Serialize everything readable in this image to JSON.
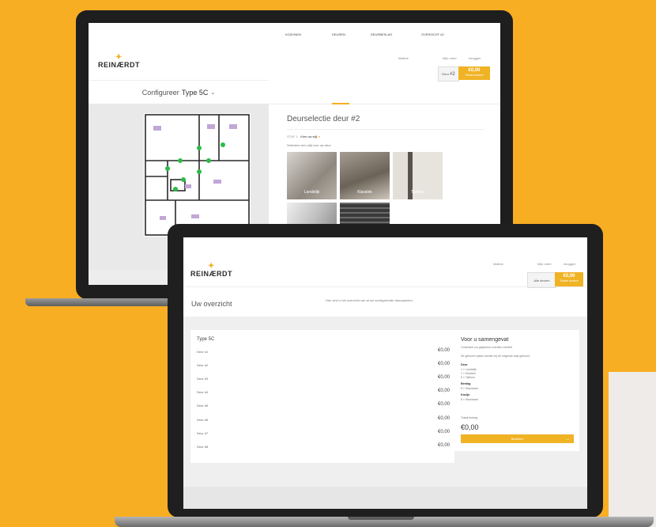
{
  "brand": {
    "name": "REINÆRDT"
  },
  "back_screen": {
    "util": {
      "mail": "Mailtoe",
      "search": "Mijn order",
      "login": "Inloggen"
    },
    "door_badge": {
      "label": "Deur",
      "number": "#2"
    },
    "total": {
      "amount": "€0,00",
      "note": "Totale kosten"
    },
    "configure": {
      "prefix": "Configureer",
      "type": "Type 5C"
    },
    "tabs": [
      {
        "label": "KOZIJNEN"
      },
      {
        "label": "DEUREN"
      },
      {
        "label": "DEURBESLAG"
      },
      {
        "label": "OVERZICHT"
      }
    ],
    "last_tab_suffix": "#2",
    "title": "Deurselectie deur #2",
    "step": {
      "num": "STAP 1",
      "label": "Kies uw stijl"
    },
    "subtitle": "Selecteer een stijl voor uw deur",
    "doors": [
      {
        "label": "Landelijk"
      },
      {
        "label": "Klassiek"
      },
      {
        "label": "Tijdloos"
      },
      {
        "label": ""
      },
      {
        "label": ""
      }
    ]
  },
  "front_screen": {
    "util": {
      "mail": "Mailtoe",
      "search": "Mijn order",
      "login": "Inloggen"
    },
    "header_box": {
      "label": "Alle deuren"
    },
    "total": {
      "amount": "€0,00",
      "note": "Totale kosten"
    },
    "title": "Uw overzicht",
    "intro": "Hier vind u het overzicht van al uw configureerde deurpanelen.",
    "type": "Type 5C",
    "rows": [
      {
        "label": "Deur #1",
        "price": "€0,00"
      },
      {
        "label": "Deur #2",
        "price": "€0,00"
      },
      {
        "label": "Deur #3",
        "price": "€0,00"
      },
      {
        "label": "Deur #4",
        "price": "€0,00"
      },
      {
        "label": "Deur #5",
        "price": "€0,00"
      },
      {
        "label": "Deur #6",
        "price": "€0,00"
      },
      {
        "label": "Deur #7",
        "price": "€0,00"
      },
      {
        "label": "Deur #8",
        "price": "€0,00"
      }
    ],
    "summary": {
      "title": "Voor u samengevat",
      "desc1": "Controleer uw gegevens voordat u bestelt",
      "desc2": "De gekozen opties worden bij de volgende stap getoond",
      "door_heading": "Deur",
      "door_items": [
        "1 × Landelijk",
        "1 × Klassiek",
        "6 × Tijdloos"
      ],
      "fittings_heading": "Beslag",
      "fittings_items": [
        "8 × Standaard"
      ],
      "frames_heading": "Kozijn",
      "frames_items": [
        "8 × Standaard"
      ],
      "total_label": "Totaal bedrag",
      "total_value": "€0,00",
      "cta": "Bestellen"
    }
  },
  "colors": {
    "accent": "#F8AE22",
    "brand_gold": "#F0B324"
  }
}
